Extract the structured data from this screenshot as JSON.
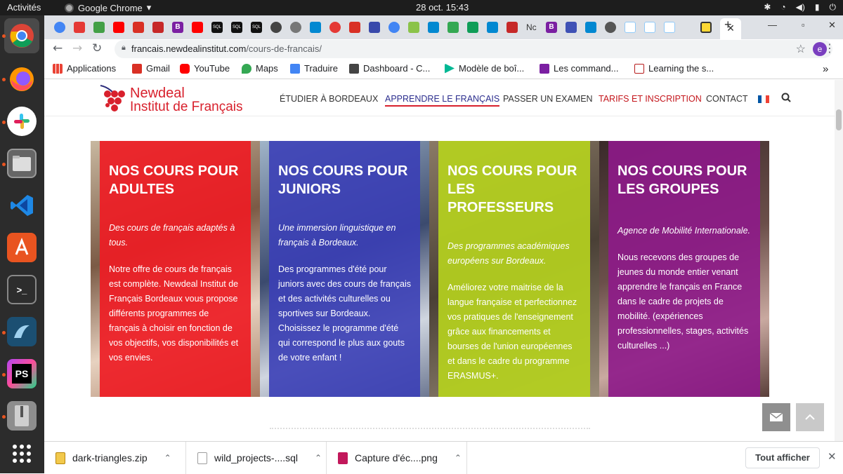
{
  "desktop": {
    "activities": "Activités",
    "app_name": "Google Chrome",
    "clock": "28 oct.  15:43"
  },
  "dock": {
    "items": [
      "chrome",
      "firefox",
      "slack",
      "files",
      "vscode",
      "app-center",
      "terminal",
      "mysql-workbench",
      "phpstorm",
      "archive",
      "show-applications"
    ],
    "ps_label": "PS"
  },
  "browser": {
    "url_host": "francais.newdealinstitut.com",
    "url_path": "/cours-de-francais/",
    "profile_initial": "e",
    "tab_labels": [
      "SQL",
      "SQL",
      "SQL",
      "Nc"
    ],
    "bookmarks": [
      {
        "label": "Applications",
        "icon": "apps-grid-icon",
        "color": "#4285f4"
      },
      {
        "label": "Gmail",
        "icon": "gmail-icon",
        "color": "#d93025"
      },
      {
        "label": "YouTube",
        "icon": "youtube-icon",
        "color": "#ff0000"
      },
      {
        "label": "Maps",
        "icon": "maps-icon",
        "color": "#34a853"
      },
      {
        "label": "Traduire",
        "icon": "translate-icon",
        "color": "#4285f4"
      },
      {
        "label": "Dashboard - C...",
        "icon": "cube-icon",
        "color": "#444444"
      },
      {
        "label": "Modèle de boî...",
        "icon": "play-icon",
        "color": "#00b894"
      },
      {
        "label": "Les command...",
        "icon": "slack-icon",
        "color": "#7b1fa2"
      },
      {
        "label": "Learning the s...",
        "icon": "page-icon",
        "color": "#b71c1c"
      }
    ]
  },
  "site": {
    "logo_line1": "Newdeal",
    "logo_line2": "Institut de Français",
    "nav": [
      {
        "label": "ÉTUDIER À BORDEAUX",
        "state": "normal"
      },
      {
        "label": "APPRENDRE LE FRANÇAIS",
        "state": "active"
      },
      {
        "label": "PASSER UN EXAMEN",
        "state": "normal"
      },
      {
        "label": "TARIFS ET INSCRIPTION",
        "state": "highlight"
      },
      {
        "label": "CONTACT",
        "state": "normal"
      }
    ],
    "cards": [
      {
        "title": "NOS COURS POUR ADULTES",
        "lead": "Des cours de français adaptés à tous.",
        "body": "Notre offre de cours de français est complète. Newdeal Institut de Français Bordeaux vous propose différents programmes de français à choisir en fonction de vos objectifs, vos disponibilités et vos envies.",
        "color": "#ee1c24"
      },
      {
        "title": "NOS COURS POUR JUNIORS",
        "lead": "Une immersion linguistique en français à Bordeaux.",
        "body": "Des programmes d'été pour juniors avec des cours de français et des activités culturelles ou sportives sur Bordeaux. Choisissez le programme d'été qui correspond le plus aux gouts de votre enfant !",
        "color": "#3b3fb6"
      },
      {
        "title": "NOS COURS POUR LES PROFESSEURS",
        "lead": "Des programmes académiques européens sur Bordeaux.",
        "body": "Améliorez votre maitrise de la langue française et perfectionnez vos pratiques de l'enseignement grâce aux financements et bourses de l'union européennes et dans le cadre du programme ERASMUS+.",
        "color": "#b5d11e"
      },
      {
        "title": "NOS COURS POUR LES GROUPES",
        "lead": "Agence de Mobilité Internationale.",
        "body": "Nous recevons des groupes de jeunes du monde entier venant apprendre le français en France dans le cadre de projets de mobilité. (expériences professionnelles, stages, activités culturelles ...)",
        "color": "#8e1a8a"
      }
    ]
  },
  "downloads": {
    "items": [
      {
        "name": "dark-triangles.zip",
        "icon": "zip-file-icon",
        "color": "#f2c94c"
      },
      {
        "name": "wild_projects-....sql",
        "icon": "document-icon",
        "color": "#9e9e9e"
      },
      {
        "name": "Capture d'éc....png",
        "icon": "image-file-icon",
        "color": "#c2185b"
      }
    ],
    "show_all": "Tout afficher"
  }
}
